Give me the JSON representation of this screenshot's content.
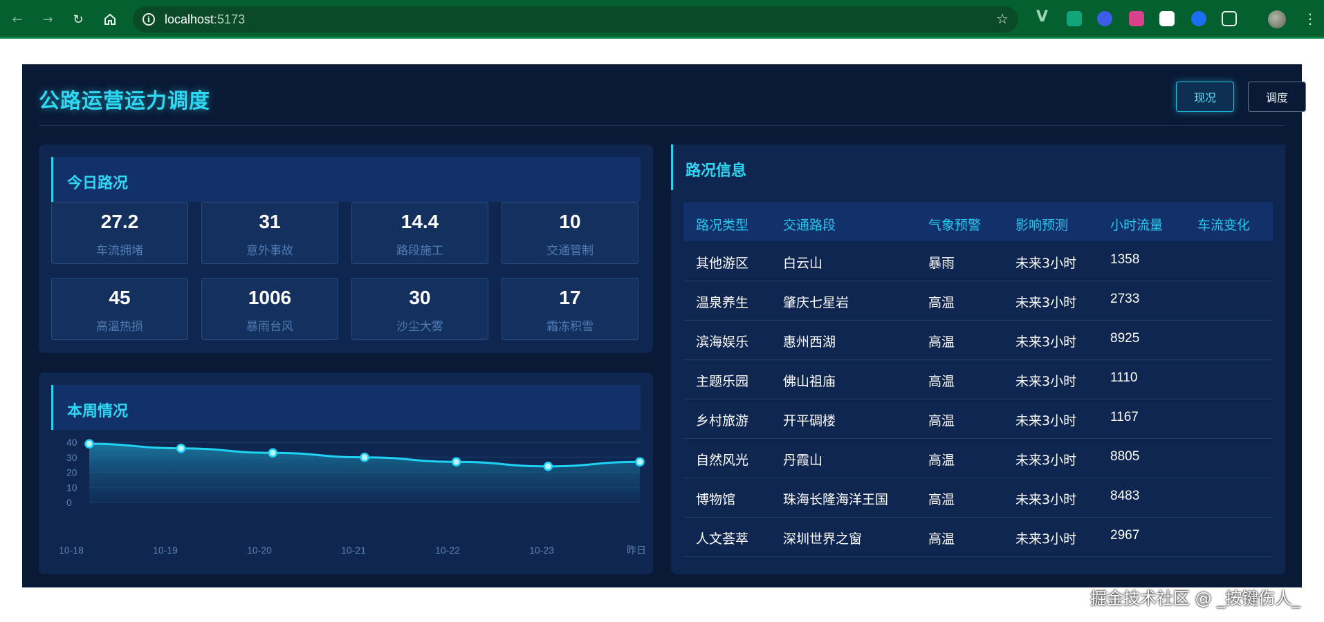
{
  "browser": {
    "url_host": "localhost",
    "url_port": ":5173"
  },
  "dashboard": {
    "title": "公路运营运力调度",
    "buttons": [
      "现况",
      "调度"
    ]
  },
  "today": {
    "title": "今日路况",
    "stats": [
      {
        "value": "27.2",
        "label": "车流拥堵"
      },
      {
        "value": "31",
        "label": "意外事故"
      },
      {
        "value": "14.4",
        "label": "路段施工"
      },
      {
        "value": "10",
        "label": "交通管制"
      },
      {
        "value": "45",
        "label": "高温热损"
      },
      {
        "value": "1006",
        "label": "暴雨台风"
      },
      {
        "value": "30",
        "label": "沙尘大雾"
      },
      {
        "value": "17",
        "label": "霜冻积雪"
      }
    ]
  },
  "week": {
    "title": "本周情况"
  },
  "chart_data": {
    "type": "area",
    "title": "本周情况",
    "xlabel": "",
    "ylabel": "",
    "categories": [
      "10-18",
      "10-19",
      "10-20",
      "10-21",
      "10-22",
      "10-23",
      "昨日"
    ],
    "values": [
      39,
      36,
      33,
      30,
      27,
      24,
      27
    ],
    "y_ticks": [
      "40",
      "30",
      "20",
      "10",
      "0"
    ],
    "ylim": [
      0,
      40
    ],
    "grid": true,
    "color": "#1fd3f5"
  },
  "road_info": {
    "title": "路况信息",
    "columns": [
      "路况类型",
      "交通路段",
      "气象预警",
      "影响预测",
      "小时流量",
      "车流变化"
    ],
    "rows": [
      [
        "其他游区",
        "白云山",
        "暴雨",
        "未来3小时",
        "1358",
        ""
      ],
      [
        "温泉养生",
        "肇庆七星岩",
        "高温",
        "未来3小时",
        "2733",
        ""
      ],
      [
        "滨海娱乐",
        "惠州西湖",
        "高温",
        "未来3小时",
        "8925",
        ""
      ],
      [
        "主题乐园",
        "佛山祖庙",
        "高温",
        "未来3小时",
        "1110",
        ""
      ],
      [
        "乡村旅游",
        "开平碉楼",
        "高温",
        "未来3小时",
        "1167",
        ""
      ],
      [
        "自然风光",
        "丹霞山",
        "高温",
        "未来3小时",
        "8805",
        ""
      ],
      [
        "博物馆",
        "珠海长隆海洋王国",
        "高温",
        "未来3小时",
        "8483",
        ""
      ],
      [
        "人文荟萃",
        "深圳世界之窗",
        "高温",
        "未来3小时",
        "2967",
        ""
      ]
    ]
  },
  "watermark": "掘金技术社区 @ _按键伤人_",
  "colors": {
    "accent": "#2fd8f2",
    "background": "#0a1a36",
    "panel": "#0f2650",
    "browser_bar": "#04612f"
  }
}
